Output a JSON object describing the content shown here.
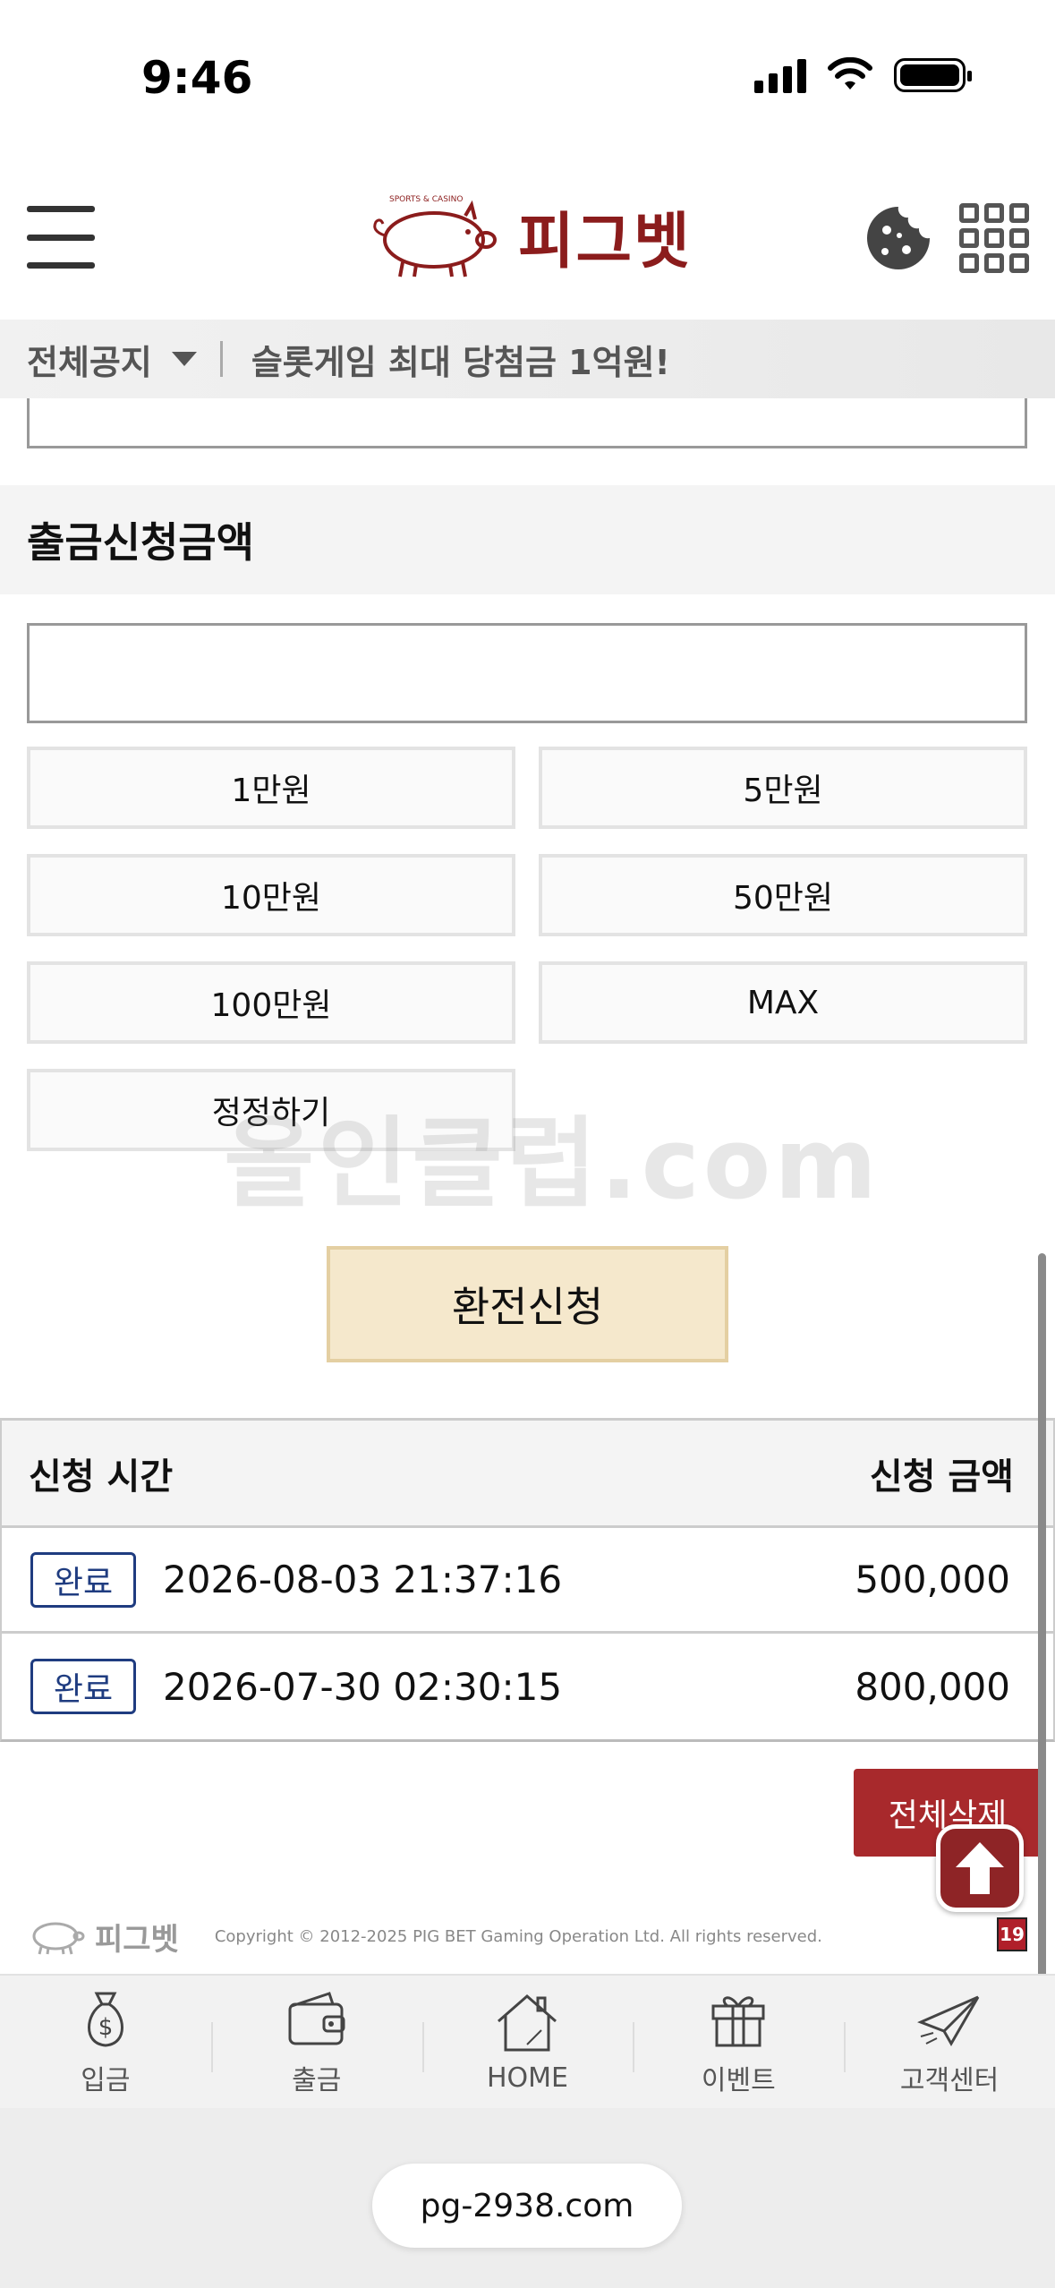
{
  "status": {
    "time": "9:46"
  },
  "header": {
    "logo_text": "피그벳",
    "logo_tagline": "SPORTS & CASINO"
  },
  "notice": {
    "label": "전체공지",
    "text": "슬롯게임 최대 당첨금 1억원!"
  },
  "form": {
    "section_title": "출금신청금액",
    "amount_value": "",
    "amount_buttons": [
      "1만원",
      "5만원",
      "10만원",
      "50만원",
      "100만원",
      "MAX"
    ],
    "reset_label": "정정하기",
    "submit_label": "환전신청"
  },
  "watermark": "올인클럽.com",
  "history": {
    "col_time": "신청 시간",
    "col_amount": "신청 금액",
    "rows": [
      {
        "status": "완료",
        "time": "2026-08-03 21:37:16",
        "amount": "500,000"
      },
      {
        "status": "완료",
        "time": "2026-07-30 02:30:15",
        "amount": "800,000"
      }
    ],
    "delete_all_label": "전체삭제"
  },
  "footer": {
    "logo_text": "피그벳",
    "copyright": "Copyright © 2012-2025 PIG BET Gaming Operation Ltd. All rights reserved.",
    "age_badge": "19"
  },
  "bottom_nav": {
    "items": [
      {
        "label": "입금",
        "icon": "money-bag-icon"
      },
      {
        "label": "출금",
        "icon": "wallet-icon"
      },
      {
        "label": "HOME",
        "icon": "house-icon"
      },
      {
        "label": "이벤트",
        "icon": "gift-icon"
      },
      {
        "label": "고객센터",
        "icon": "paper-plane-icon"
      }
    ]
  },
  "browser": {
    "url": "pg-2938.com"
  },
  "colors": {
    "brand": "#8b1c1c",
    "accent_button": "#f5e8cc",
    "badge_blue": "#1f3c80",
    "delete_red": "#a8292c"
  }
}
